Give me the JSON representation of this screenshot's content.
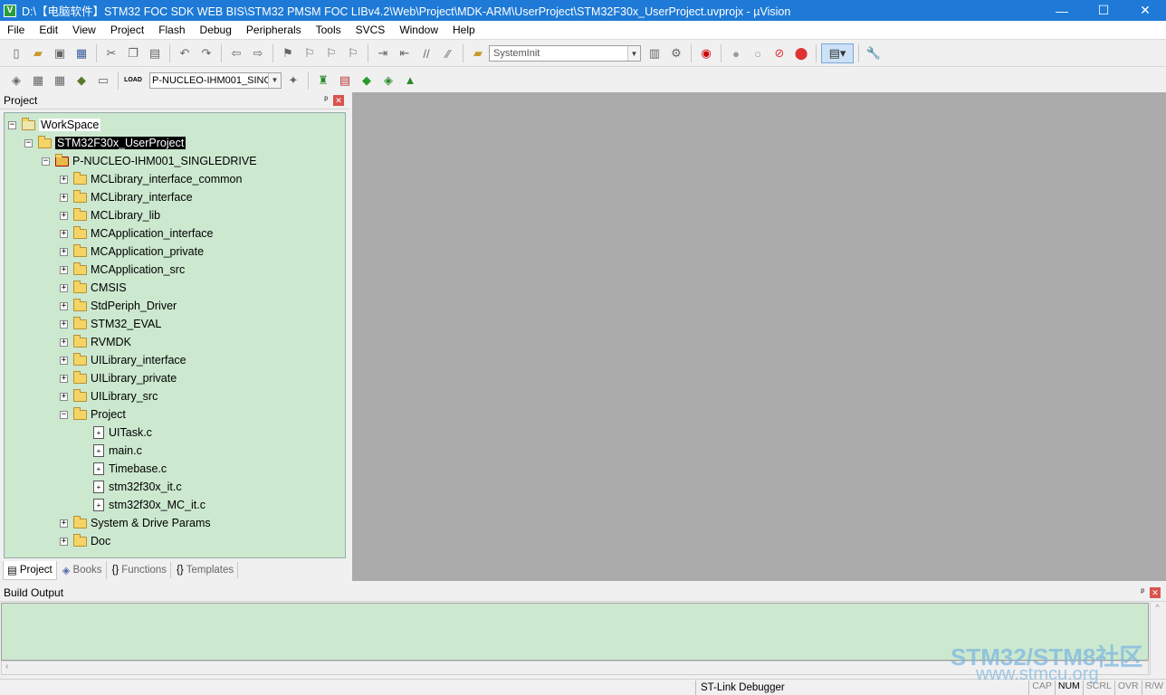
{
  "window": {
    "title": "D:\\【电脑软件】STM32 FOC SDK WEB BIS\\STM32 PMSM FOC LIBv4.2\\Web\\Project\\MDK-ARM\\UserProject\\STM32F30x_UserProject.uvprojx - µVision",
    "minimize": "—",
    "maximize": "☐",
    "close": "✕"
  },
  "menu": [
    "File",
    "Edit",
    "View",
    "Project",
    "Flash",
    "Debug",
    "Peripherals",
    "Tools",
    "SVCS",
    "Window",
    "Help"
  ],
  "toolbar": {
    "function_combo": "SystemInit",
    "target_combo": "P-NUCLEO-IHM001_SING",
    "load_label": "LOAD"
  },
  "project_panel": {
    "title": "Project",
    "pin": "ᵖ",
    "close": "✕",
    "workspace": "WorkSpace",
    "project": "STM32F30x_UserProject",
    "target": "P-NUCLEO-IHM001_SINGLEDRIVE",
    "groups": [
      "MCLibrary_interface_common",
      "MCLibrary_interface",
      "MCLibrary_lib",
      "MCApplication_interface",
      "MCApplication_private",
      "MCApplication_src",
      "CMSIS",
      "StdPeriph_Driver",
      "STM32_EVAL",
      "RVMDK",
      "UILibrary_interface",
      "UILibrary_private",
      "UILibrary_src"
    ],
    "open_group": "Project",
    "files": [
      "UITask.c",
      "main.c",
      "Timebase.c",
      "stm32f30x_it.c",
      "stm32f30x_MC_it.c"
    ],
    "trailing_groups": [
      "System & Drive Params",
      "Doc"
    ],
    "tabs": [
      "Project",
      "Books",
      "Functions",
      "Templates"
    ]
  },
  "build_output": {
    "title": "Build Output",
    "pin": "ᵖ",
    "close": "✕"
  },
  "status": {
    "debugger": "ST-Link Debugger",
    "indicators": [
      "CAP",
      "NUM",
      "SCRL",
      "OVR",
      "R/W"
    ]
  },
  "watermark": {
    "line1": "STM32/STM8社区",
    "line2": "www.stmcu.org"
  }
}
